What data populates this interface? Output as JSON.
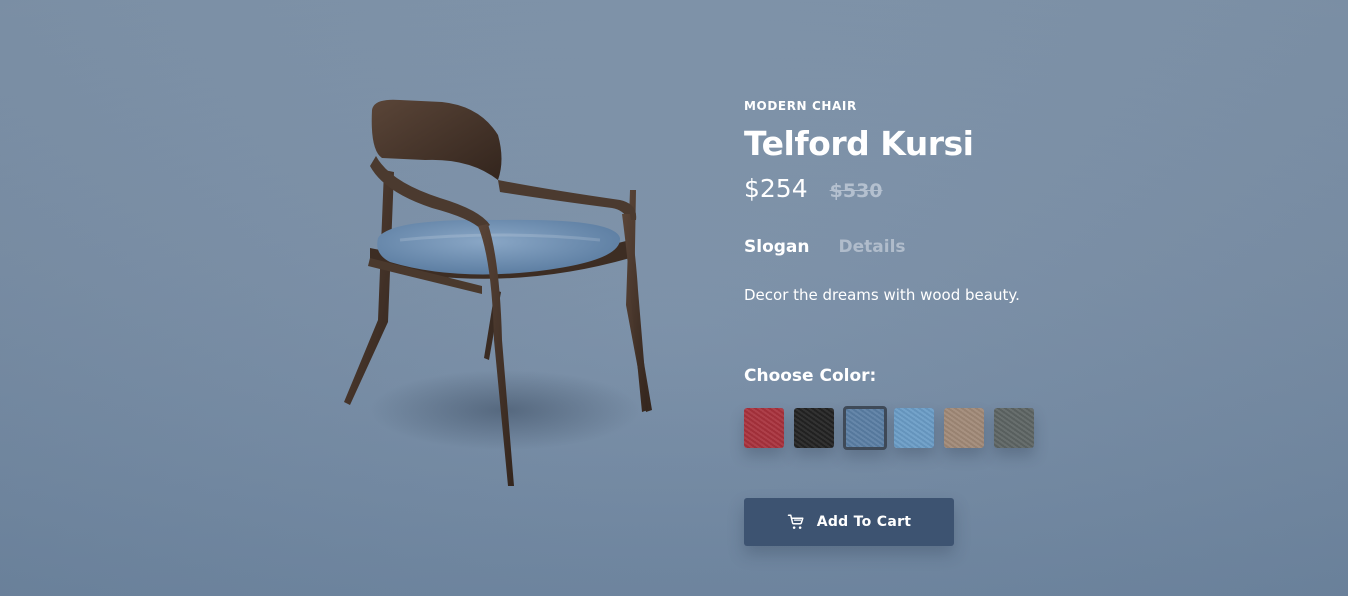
{
  "product": {
    "category": "MODERN CHAIR",
    "title": "Telford Kursi",
    "price_current": "$254",
    "price_old": "$530",
    "image_icon": "chair-image"
  },
  "tabs": [
    {
      "label": "Slogan",
      "active": true
    },
    {
      "label": "Details",
      "active": false
    }
  ],
  "tab_content": "Decor the dreams with wood beauty.",
  "colors": {
    "label": "Choose Color:",
    "selected_index": 2,
    "options": [
      {
        "name": "red",
        "hex": "#a8313c"
      },
      {
        "name": "black",
        "hex": "#232323"
      },
      {
        "name": "denim-blue",
        "hex": "#5a7ea4"
      },
      {
        "name": "light-blue",
        "hex": "#6a9cc6"
      },
      {
        "name": "tan",
        "hex": "#a08977"
      },
      {
        "name": "grey",
        "hex": "#5d6463"
      }
    ]
  },
  "cart_button": {
    "label": "Add To Cart",
    "icon": "cart-icon",
    "color": "#3d5371"
  }
}
